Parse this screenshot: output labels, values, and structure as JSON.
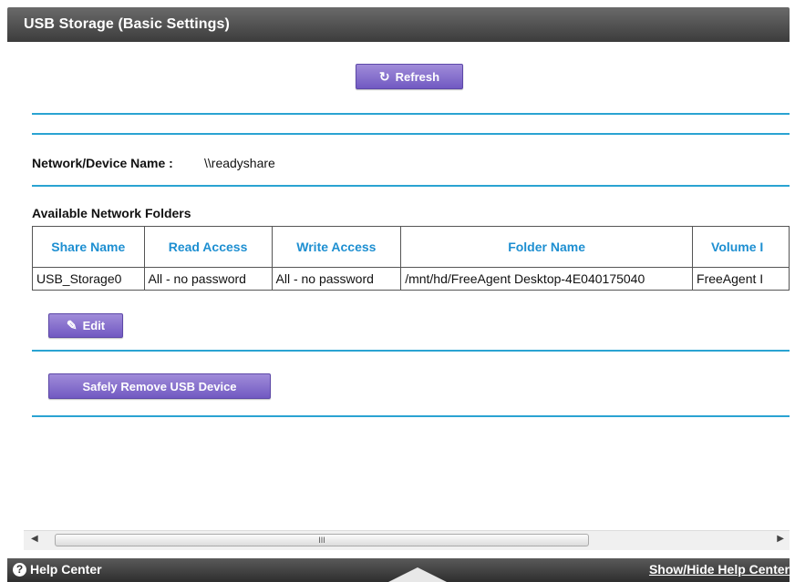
{
  "title": "USB Storage (Basic Settings)",
  "refresh_label": "Refresh",
  "device": {
    "label": "Network/Device Name :",
    "value": "\\\\readyshare"
  },
  "folders": {
    "heading": "Available Network Folders",
    "columns": [
      "Share Name",
      "Read Access",
      "Write Access",
      "Folder Name",
      "Volume I"
    ],
    "rows": [
      [
        "USB_Storage0",
        "All - no password",
        "All - no password",
        "/mnt/hd/FreeAgent Desktop-4E040175040",
        "FreeAgent I"
      ]
    ]
  },
  "edit_label": "Edit",
  "remove_label": "Safely Remove USB Device",
  "scroll": {
    "thumb_glyph": "III",
    "left_arrow": "◀",
    "right_arrow": "▶"
  },
  "footer": {
    "help_label": "Help Center",
    "toggle_label": "Show/Hide Help Center"
  },
  "colors": {
    "accent_rule": "#2aa3d2",
    "header_text": "#1e8fd1",
    "button": "#7a63c8",
    "titlebar": "#4a4a4a"
  },
  "icons": [
    "refresh-icon",
    "pencil-icon",
    "help-icon"
  ]
}
